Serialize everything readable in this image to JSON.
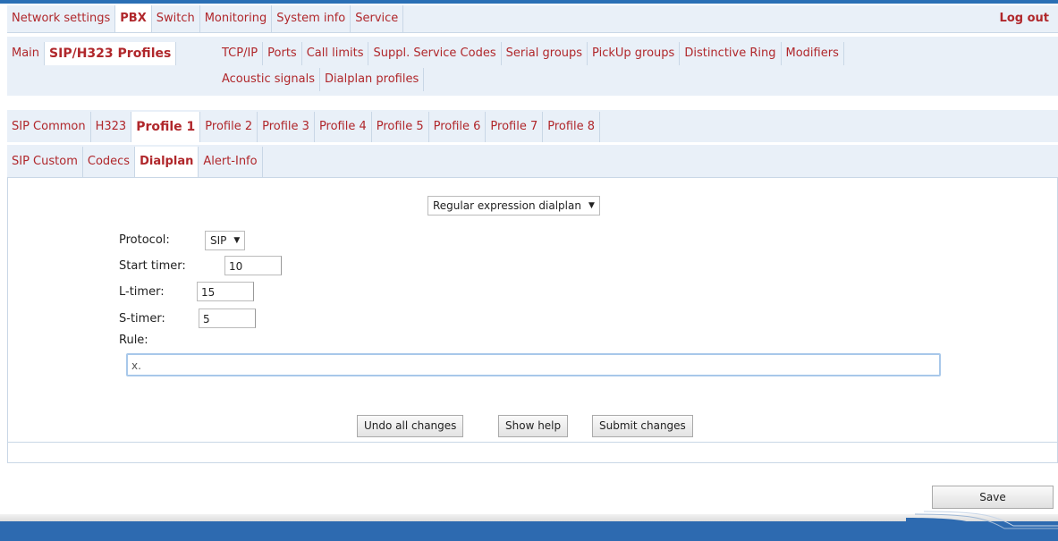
{
  "top_menu": [
    "Network settings",
    "PBX",
    "Switch",
    "Monitoring",
    "System info",
    "Service"
  ],
  "top_active": "PBX",
  "logout": "Log out",
  "pbx_left": [
    "Main",
    "SIP/H323 Profiles"
  ],
  "pbx_row1": [
    "TCP/IP",
    "Ports",
    "Call limits",
    "Suppl. Service Codes",
    "Serial groups",
    "PickUp groups",
    "Distinctive Ring",
    "Modifiers"
  ],
  "pbx_row2": [
    "Acoustic signals",
    "Dialplan profiles"
  ],
  "profile_tabs": [
    "SIP Common",
    "H323",
    "Profile 1",
    "Profile 2",
    "Profile 3",
    "Profile 4",
    "Profile 5",
    "Profile 6",
    "Profile 7",
    "Profile 8"
  ],
  "sub_tabs": [
    "SIP Custom",
    "Codecs",
    "Dialplan",
    "Alert-Info"
  ],
  "form": {
    "dialplan_mode": "Regular expression dialplan",
    "protocol_label": "Protocol:",
    "protocol_value": "SIP",
    "start_timer_label": "Start timer:",
    "start_timer_value": "10",
    "l_timer_label": "L-timer:",
    "l_timer_value": "15",
    "s_timer_label": "S-timer:",
    "s_timer_value": "5",
    "rule_label": "Rule:",
    "rule_value": "x."
  },
  "buttons": {
    "undo": "Undo all changes",
    "help": "Show help",
    "submit": "Submit changes",
    "save": "Save"
  },
  "colors": {
    "accent_red": "#b0272b",
    "menu_bg": "#e9f0f8",
    "brand_blue": "#2d6ab0"
  }
}
